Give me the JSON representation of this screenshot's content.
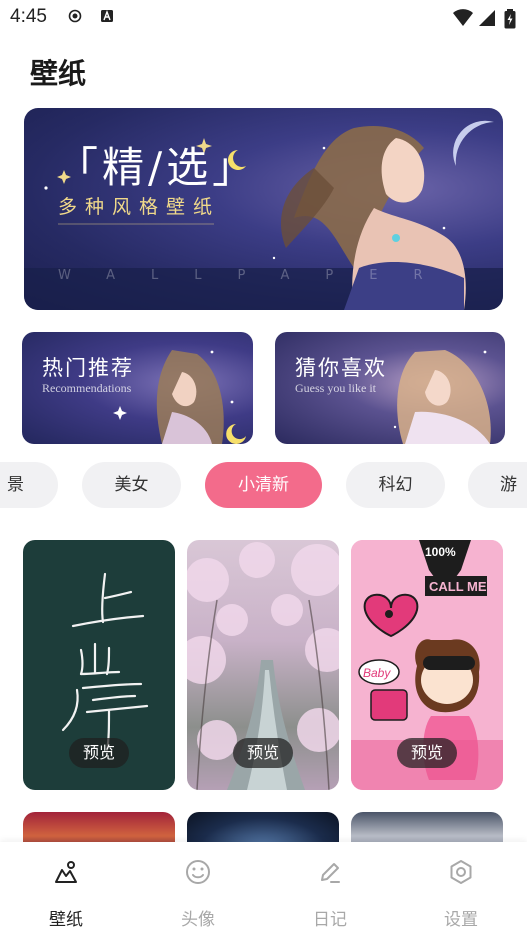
{
  "status_bar": {
    "time": "4:45"
  },
  "page": {
    "title": "壁纸"
  },
  "hero": {
    "title": "「精/选」",
    "subtitle": "多种风格壁纸",
    "watermark": "WALLPAPER"
  },
  "categories": [
    {
      "title": "热门推荐",
      "subtitle": "Recommendations"
    },
    {
      "title": "猜你喜欢",
      "subtitle": "Guess you like it"
    }
  ],
  "chips": [
    {
      "label": "景"
    },
    {
      "label": "美女"
    },
    {
      "label": "小清新"
    },
    {
      "label": "科幻"
    },
    {
      "label": "游"
    }
  ],
  "active_chip": "小清新",
  "wallpapers": [
    {
      "preview_label": "预览",
      "image_text": "上岸"
    },
    {
      "preview_label": "预览"
    },
    {
      "preview_label": "预览",
      "image_text": [
        "CALL ME",
        "100%",
        "Baby"
      ]
    }
  ],
  "tabs": [
    {
      "label": "壁纸",
      "icon": "wallpaper-icon"
    },
    {
      "label": "头像",
      "icon": "smile-icon"
    },
    {
      "label": "日记",
      "icon": "pencil-icon"
    },
    {
      "label": "设置",
      "icon": "settings-icon"
    }
  ],
  "active_tab": "壁纸",
  "colors": {
    "accent": "#f36b8b",
    "tab_inactive": "#a8a8a8"
  }
}
